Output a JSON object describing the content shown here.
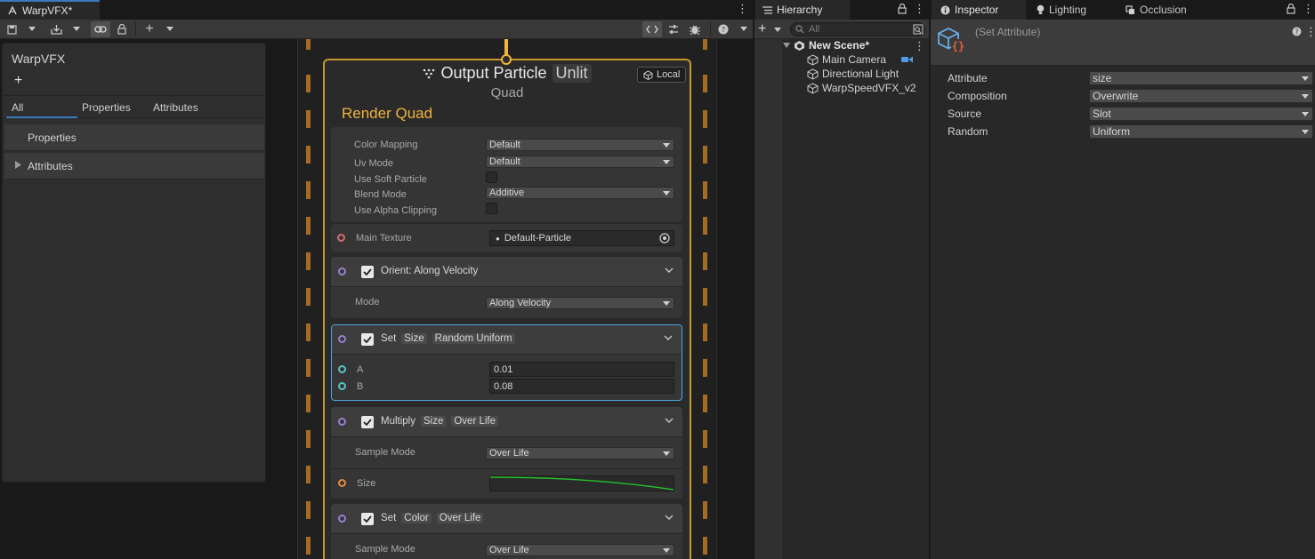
{
  "vfx_window": {
    "tab_title": "WarpVFX*",
    "blackboard": {
      "title": "WarpVFX",
      "add_label": "+",
      "tabs": [
        "All",
        "Properties",
        "Attributes"
      ],
      "categories": [
        "Properties",
        "Attributes"
      ]
    },
    "context": {
      "title": "Output Particle",
      "title_pill": "Unlit",
      "subtitle": "Quad",
      "space_label": "Local",
      "section_title": "Render Quad",
      "settings": [
        {
          "label": "Color Mapping",
          "value": "Default",
          "type": "dropdown"
        },
        {
          "label": "Uv Mode",
          "value": "Default",
          "type": "dropdown"
        },
        {
          "label": "Use Soft Particle",
          "value": "",
          "type": "checkbox"
        },
        {
          "label": "Blend Mode",
          "value": "Additive",
          "type": "dropdown"
        },
        {
          "label": "Use Alpha Clipping",
          "value": "",
          "type": "checkbox"
        }
      ],
      "main_texture": {
        "label": "Main Texture",
        "value": "Default-Particle"
      },
      "blocks": [
        {
          "title": [
            "Orient: Along Velocity"
          ],
          "rows": [
            {
              "label": "Mode",
              "value": "Along Velocity"
            }
          ]
        },
        {
          "title": [
            "Set",
            "Size",
            "Random Uniform"
          ],
          "rows": [
            {
              "label": "A",
              "value": "0.01"
            },
            {
              "label": "B",
              "value": "0.08"
            }
          ]
        },
        {
          "title": [
            "Multiply",
            "Size",
            "Over Life"
          ],
          "rows": [
            {
              "label": "Sample Mode",
              "value": "Over Life"
            },
            {
              "label": "Size",
              "value": ""
            }
          ]
        },
        {
          "title": [
            "Set",
            "Color",
            "Over Life"
          ],
          "rows": [
            {
              "label": "Sample Mode",
              "value": "Over Life"
            }
          ]
        }
      ]
    }
  },
  "hierarchy": {
    "tab_title": "Hierarchy",
    "search_placeholder": "All",
    "scene": "New Scene*",
    "items": [
      "Main Camera",
      "Directional Light",
      "WarpSpeedVFX_v2"
    ]
  },
  "inspector": {
    "tabs": [
      "Inspector",
      "Lighting",
      "Occlusion"
    ],
    "title": "(Set Attribute)",
    "properties": [
      {
        "label": "Attribute",
        "value": "size"
      },
      {
        "label": "Composition",
        "value": "Overwrite"
      },
      {
        "label": "Source",
        "value": "Slot"
      },
      {
        "label": "Random",
        "value": "Uniform"
      }
    ]
  },
  "colors": {
    "accent_blue": "#3a79bb",
    "context_border": "#c79a2f",
    "section_title": "#f0b33a",
    "selected_block": "#4aa8e0",
    "curve": "#22c22a"
  }
}
